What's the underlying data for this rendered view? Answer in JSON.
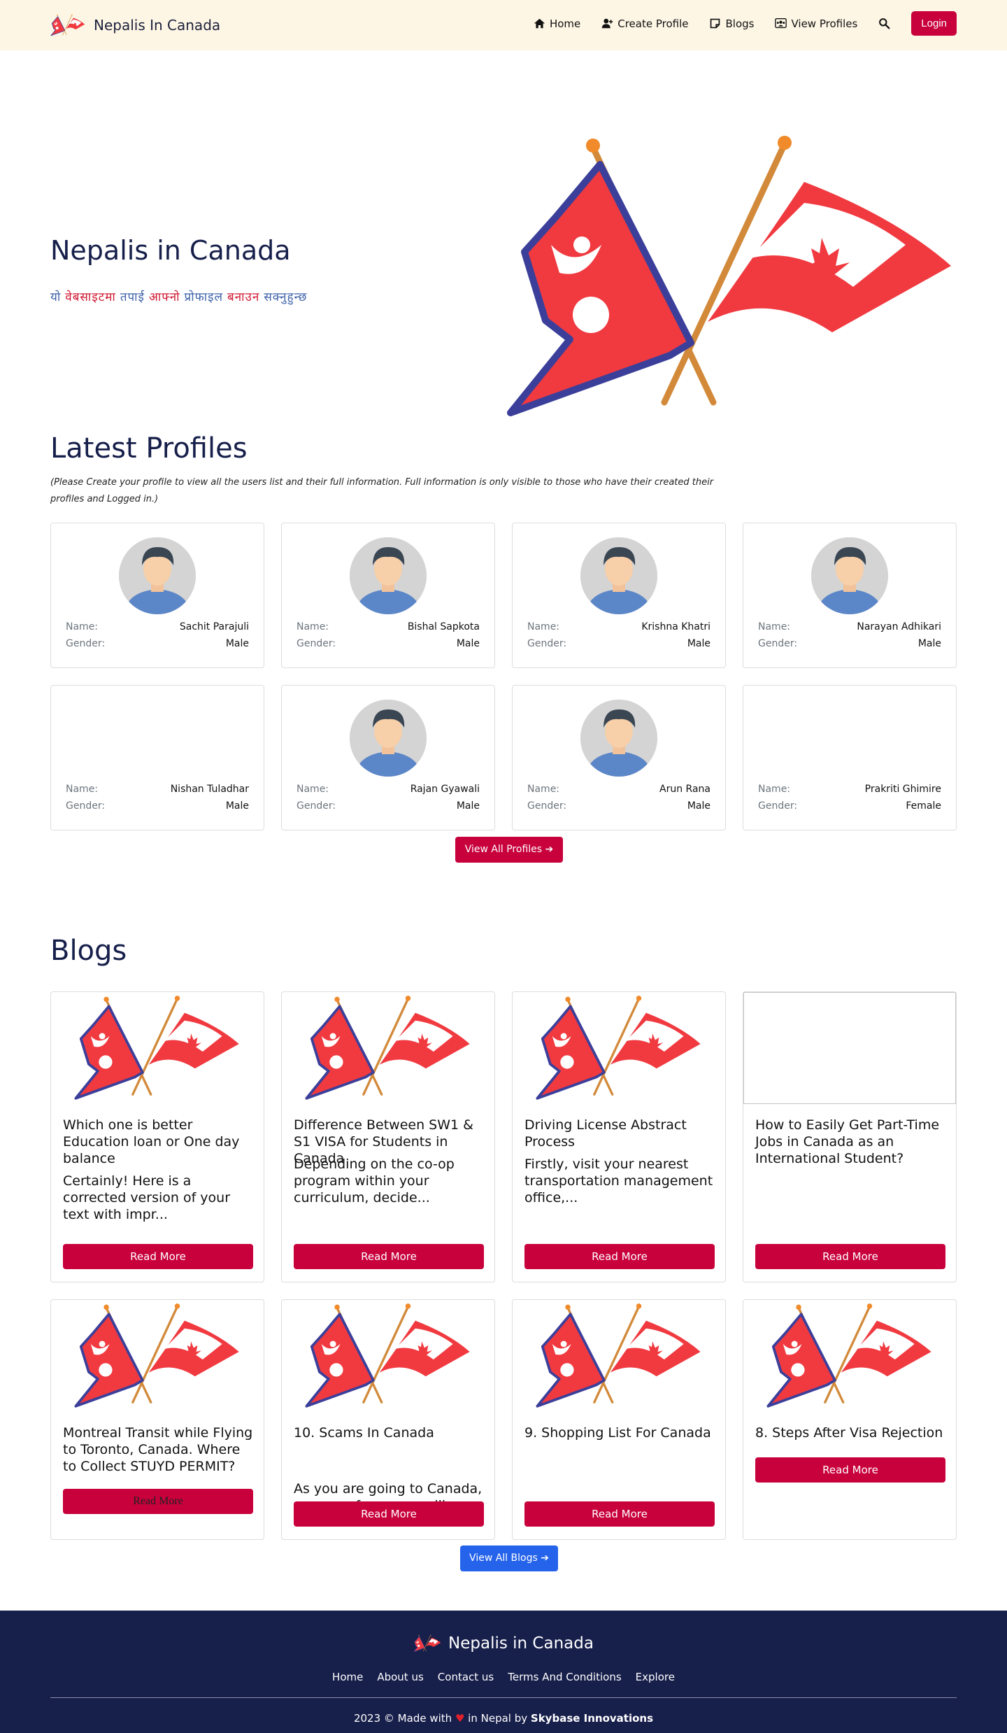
{
  "nav": {
    "brand": "Nepalis In Canada",
    "links": [
      {
        "label": "Home",
        "icon": "home-icon"
      },
      {
        "label": "Create Profile",
        "icon": "user-plus-icon"
      },
      {
        "label": "Blogs",
        "icon": "note-icon"
      },
      {
        "label": "View Profiles",
        "icon": "users-icon"
      }
    ],
    "login": "Login"
  },
  "hero": {
    "title": "Nepalis in Canada",
    "subtitle_words": [
      "यो",
      "वेबसाइटमा",
      "तपाई",
      "आफ्नो",
      "प्रोफाइल",
      "बनाउन",
      "सक्नुहुन्छ"
    ]
  },
  "profiles": {
    "title": "Latest Profiles",
    "note": "(Please Create your profile to view all the users list and their full information. Full information is only visible to those who have their created their profiles and Logged in.)",
    "name_label": "Name:",
    "gender_label": "Gender:",
    "items": [
      {
        "name": "Sachit Parajuli",
        "gender": "Male",
        "avatar": true
      },
      {
        "name": "Bishal Sapkota",
        "gender": "Male",
        "avatar": true
      },
      {
        "name": "Krishna Khatri",
        "gender": "Male",
        "avatar": true
      },
      {
        "name": "Narayan Adhikari",
        "gender": "Male",
        "avatar": true
      },
      {
        "name": "Nishan Tuladhar",
        "gender": "Male",
        "avatar": false
      },
      {
        "name": "Rajan Gyawali",
        "gender": "Male",
        "avatar": true
      },
      {
        "name": "Arun Rana",
        "gender": "Male",
        "avatar": true
      },
      {
        "name": "Prakriti Ghimire",
        "gender": "Female",
        "avatar": false
      }
    ],
    "view_all": "View All Profiles ➔"
  },
  "blogs": {
    "title": "Blogs",
    "read_more": "Read More",
    "items": [
      {
        "title": "Which one is better Education loan or One day balance",
        "excerpt": "Certainly! Here is a corrected version of your text with impr...",
        "image": true
      },
      {
        "title": "Difference Between SW1 & S1 VISA for Students in Canada",
        "excerpt": "Depending on the co-op program within your curriculum, decide...",
        "image": true
      },
      {
        "title": "Driving License Abstract Process",
        "excerpt": "Firstly, visit your nearest transportation management office,...",
        "image": true
      },
      {
        "title": "How to Easily Get Part-Time Jobs in Canada as an International Student?",
        "excerpt": "",
        "image": false
      },
      {
        "title": "Montreal Transit while Flying to Toronto, Canada. Where to Collect STUYD PERMIT?",
        "excerpt": "",
        "image": true
      },
      {
        "title": "10. Scams In Canada",
        "excerpt": "As you are going to Canada, you may face scams like...",
        "image": true
      },
      {
        "title": "9. Shopping List For Canada",
        "excerpt": "",
        "image": true
      },
      {
        "title": "8. Steps After Visa Rejection",
        "excerpt": "",
        "image": true
      }
    ],
    "view_all": "View All Blogs ➔"
  },
  "footer": {
    "brand": "Nepalis in Canada",
    "links": [
      "Home",
      "About us",
      "Contact us",
      "Terms And Conditions",
      "Explore"
    ],
    "copy_prefix": "2023 © Made with",
    "heart": "♥",
    "copy_mid": "in Nepal by",
    "company": "Skybase Innovations"
  },
  "colors": {
    "accent": "#c8003c",
    "navy": "#171f4b",
    "nav_bg": "#fdf6e5",
    "blue_button": "#2563eb"
  }
}
